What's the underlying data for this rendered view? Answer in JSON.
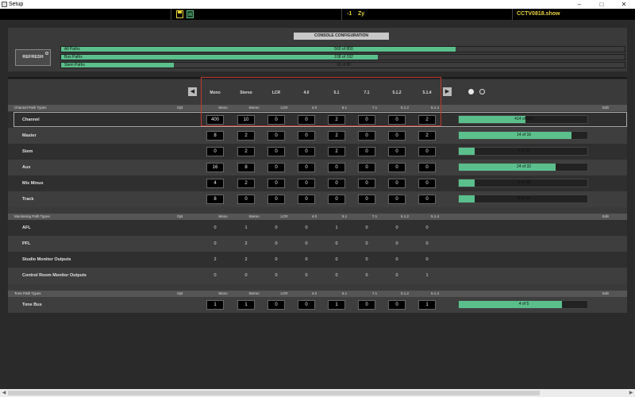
{
  "window": {
    "title": "Setup"
  },
  "topbar": {
    "offset": "-1",
    "zoom_label": "Zy",
    "show_name": "CCTV0818.show"
  },
  "config_button": "CONSOLE CONFIGURATION",
  "refresh_label": "REFRESH",
  "path_summary": [
    {
      "label": "All Paths",
      "value": "560 of 800",
      "fraction": 0.7
    },
    {
      "label": "Bus Paths",
      "value": "108 of 192",
      "fraction": 0.5625
    },
    {
      "label": "Stem Paths",
      "value": "16 of 80",
      "fraction": 0.2
    }
  ],
  "formats": [
    "Mono",
    "Stereo",
    "LCR",
    "4.0",
    "5.1",
    "7.1",
    "5.1.2",
    "5.1.4"
  ],
  "group_headers": {
    "channel": "Channel Path Types",
    "monitoring": "Monitoring Path Types",
    "tone": "Tone Path Types",
    "opt": "Opt",
    "edit": "Edit"
  },
  "channel_rows": [
    {
      "label": "Channel",
      "values": [
        "400",
        "10",
        "0",
        "0",
        "2",
        "0",
        "0",
        "2"
      ],
      "usage": "414 of 800",
      "fraction": 0.5175
    },
    {
      "label": "Master",
      "values": [
        "8",
        "2",
        "0",
        "0",
        "2",
        "0",
        "0",
        "2"
      ],
      "usage": "14 of 16",
      "fraction": 0.875
    },
    {
      "label": "Stem",
      "values": [
        "0",
        "2",
        "0",
        "0",
        "2",
        "0",
        "0",
        "0"
      ],
      "usage": "4 of 32",
      "fraction": 0.125
    },
    {
      "label": "Aux",
      "values": [
        "16",
        "8",
        "0",
        "0",
        "0",
        "0",
        "0",
        "0"
      ],
      "usage": "24 of 32",
      "fraction": 0.75
    },
    {
      "label": "Mix Minus",
      "values": [
        "4",
        "2",
        "0",
        "0",
        "0",
        "0",
        "0",
        "0"
      ],
      "usage": "6 of 48",
      "fraction": 0.125
    },
    {
      "label": "Track",
      "values": [
        "8",
        "0",
        "0",
        "0",
        "0",
        "0",
        "0",
        "0"
      ],
      "usage": "8 of 64",
      "fraction": 0.125
    }
  ],
  "monitoring_rows": [
    {
      "label": "AFL",
      "values": [
        "0",
        "1",
        "0",
        "0",
        "1",
        "0",
        "0",
        "0"
      ]
    },
    {
      "label": "PFL",
      "values": [
        "0",
        "2",
        "0",
        "0",
        "0",
        "0",
        "0",
        "0"
      ]
    },
    {
      "label": "Studio Monitor Outputs",
      "values": [
        "2",
        "2",
        "0",
        "0",
        "0",
        "0",
        "0",
        "0"
      ]
    },
    {
      "label": "Control Room Monitor Outputs",
      "values": [
        "0",
        "0",
        "0",
        "0",
        "0",
        "0",
        "0",
        "1"
      ]
    }
  ],
  "tone_rows": [
    {
      "label": "Tone Bus",
      "values": [
        "1",
        "1",
        "0",
        "0",
        "1",
        "0",
        "0",
        "1"
      ],
      "usage": "4 of 5",
      "fraction": 0.8
    }
  ],
  "colors": {
    "accent": "#5bbf8c",
    "highlight_box": "#c0392b",
    "show_name": "#e9d23a"
  }
}
